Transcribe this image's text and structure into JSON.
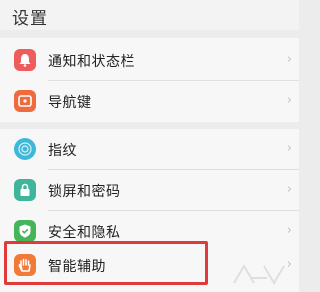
{
  "header": {
    "title": "设置"
  },
  "items": [
    {
      "label": "通知和状态栏",
      "icon": "bell-icon",
      "color": "#ee5c5c"
    },
    {
      "label": "导航键",
      "icon": "navigation-icon",
      "color": "#f06a3f"
    },
    {
      "label": "指纹",
      "icon": "fingerprint-icon",
      "color": "#3db8d9"
    },
    {
      "label": "锁屏和密码",
      "icon": "lock-icon",
      "color": "#3fb69b"
    },
    {
      "label": "安全和隐私",
      "icon": "shield-icon",
      "color": "#46b55a"
    },
    {
      "label": "智能辅助",
      "icon": "hand-icon",
      "color": "#f07a3a"
    }
  ],
  "highlight_color": "#e03a3a"
}
